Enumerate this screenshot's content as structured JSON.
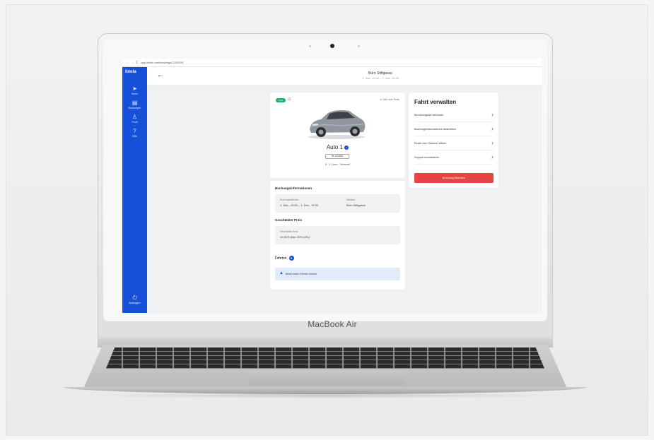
{
  "device": {
    "brand": "MacBook Air"
  },
  "browser": {
    "nav": "← → C",
    "url": "app.ibiola.com/bookings/2200293"
  },
  "sidebar": {
    "logo": "ibiola",
    "items": [
      {
        "icon": "navigation-arrow-icon",
        "glyph": "➤",
        "label": "Home"
      },
      {
        "icon": "calendar-icon",
        "glyph": "▤",
        "label": "Buchungen"
      },
      {
        "icon": "user-icon",
        "glyph": "♙",
        "label": "Profil"
      },
      {
        "icon": "help-icon",
        "glyph": "?",
        "label": "Hilfe"
      }
    ],
    "logout": {
      "icon": "power-icon",
      "glyph": "⏻",
      "label": "Ausloggen"
    }
  },
  "topbar": {
    "back": "←",
    "title": "Büro Stiftgasse",
    "subtitle": "1. Dez. 10:00 – 1. Dez. 11:30"
  },
  "car": {
    "badge": "Auto",
    "time_to": "In 15m zum Ende",
    "name": "Auto 1",
    "info": "i",
    "plate": "W 12345A",
    "specs": "5 · 1 Lime · Manuell"
  },
  "booking": {
    "title": "Buchungsinformationen",
    "period_label": "Buchungszeitraum",
    "period_value": "1. Dez., 10:00 – 1. Dez., 11:30",
    "location_label": "Standort",
    "location_value": "Büro Stiftgasse",
    "price_title": "Geschätzter Preis",
    "price_label": "Geschätzter Preis",
    "price_value": "12,50 € (inkl. 20% USt.)",
    "rides_title": "Fahrten",
    "rides_count": "0",
    "rides_notice": "Bisher keine Fahrten erfasst"
  },
  "manage": {
    "title": "Fahrt verwalten",
    "items": [
      "Benutzungsart wechseln",
      "Buchungsinformationen bearbeiten",
      "Route zum Standort öffnen",
      "Support kontaktieren"
    ],
    "end_button": "Buchung beenden"
  },
  "colors": {
    "brand_blue": "#1650d8",
    "danger": "#e74444",
    "success": "#19b36b"
  }
}
